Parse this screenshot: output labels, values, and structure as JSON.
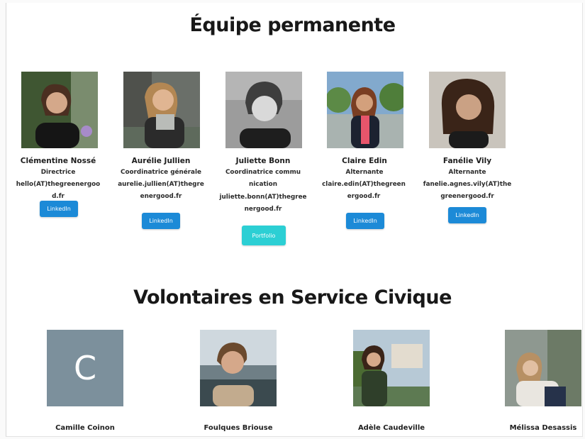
{
  "sections": {
    "permanent_title": "Équipe permanente",
    "volunteers_title": "Volontaires en Service Civique"
  },
  "permanent": [
    {
      "name": "Clémentine Nossé",
      "role": "Directrice",
      "email": "hello(AT)thegreenergood.fr",
      "button": "LinkedIn"
    },
    {
      "name": "Aurélie Jullien",
      "role": "Coordinatrice générale",
      "email": "aurelie.jullien(AT)thegreenergood.fr",
      "button": "LinkedIn"
    },
    {
      "name": "Juliette Bonn",
      "role": "Coordinatrice communication",
      "email": "juliette.bonn(AT)thegreenergood.fr",
      "button": "Portfolio"
    },
    {
      "name": "Claire Edin",
      "role": "Alternante",
      "email": "claire.edin(AT)thegreenergood.fr",
      "button": "LinkedIn"
    },
    {
      "name": "Fanélie Vily",
      "role": "Alternante",
      "email": "fanelie.agnes.vily(AT)thegreenergood.fr",
      "button": "LinkedIn"
    }
  ],
  "volunteers": [
    {
      "name": "Camille Coinon",
      "initial": "C"
    },
    {
      "name": "Foulques Briouse"
    },
    {
      "name": "Adèle Caudeville"
    },
    {
      "name": "Mélissa Desassis"
    }
  ],
  "colors": {
    "linkedin": "#1c8ad7",
    "portfolio": "#2ccfd4",
    "avatar_placeholder": "#7c909c"
  }
}
